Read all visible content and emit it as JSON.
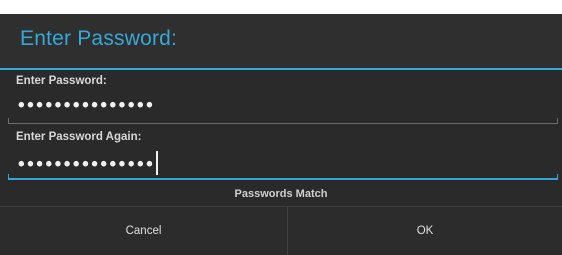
{
  "dialog": {
    "title": "Enter Password:"
  },
  "fields": [
    {
      "label": "Enter Password:",
      "value": "•••••••••••••••"
    },
    {
      "label": "Enter Password Again:",
      "value": "•••••••••••••••"
    }
  ],
  "status": "Passwords Match",
  "buttons": {
    "cancel": "Cancel",
    "ok": "OK"
  },
  "colors": {
    "accent": "#33a9dc",
    "background": "#2a2a2a"
  }
}
